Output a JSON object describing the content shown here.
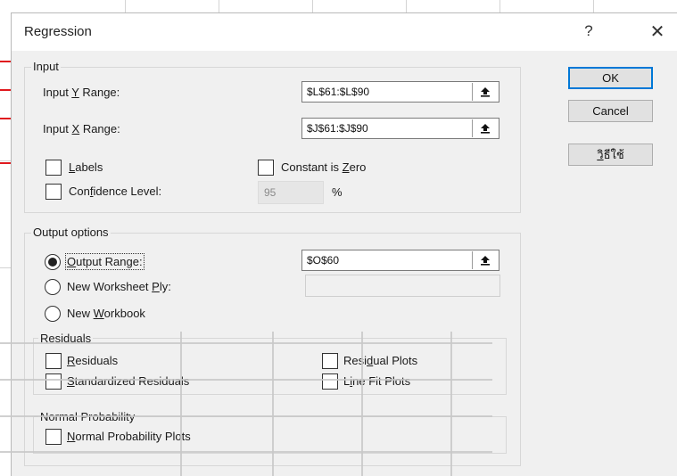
{
  "dialog": {
    "title": "Regression",
    "help_glyph": "?",
    "close_glyph": "✕"
  },
  "input_group": {
    "legend": "Input",
    "y_range": {
      "label_pre": "Input ",
      "label_key": "Y",
      "label_post": " Range:",
      "value": "$L$61:$L$90"
    },
    "x_range": {
      "label_pre": "Input ",
      "label_key": "X",
      "label_post": " Range:",
      "value": "$J$61:$J$90"
    },
    "labels": {
      "label_key": "L",
      "label_post": "abels",
      "checked": false
    },
    "constant_zero": {
      "label_pre": "Constant is ",
      "label_key": "Z",
      "label_post": "ero",
      "checked": false
    },
    "confidence": {
      "label_pre": "Con",
      "label_key": "f",
      "label_post": "idence Level:",
      "value": "95",
      "unit": "%",
      "checked": false
    }
  },
  "output_group": {
    "legend": "Output options",
    "output_range": {
      "label_pre": "",
      "label_key": "O",
      "label_post": "utput Range:",
      "value": "$O$60",
      "selected": true
    },
    "new_ply": {
      "label_pre": "New Worksheet ",
      "label_key": "P",
      "label_post": "ly:",
      "value": "",
      "selected": false
    },
    "new_workbook": {
      "label_pre": "New ",
      "label_key": "W",
      "label_post": "orkbook",
      "selected": false
    },
    "residuals_legend": "Residuals",
    "residuals": {
      "label_key": "R",
      "label_post": "esiduals",
      "checked": false
    },
    "standardized": {
      "label_key": "S",
      "label_post": "tandardized Residuals",
      "checked": false
    },
    "residual_plots": {
      "label_pre": "Resi",
      "label_key": "d",
      "label_post": "ual Plots",
      "checked": false
    },
    "line_fit": {
      "label_pre": "L",
      "label_key": "i",
      "label_post": "ne Fit Plots",
      "checked": false
    },
    "normal_legend": "Normal Probability",
    "normal_plots": {
      "label_key": "N",
      "label_post": "ormal Probability Plots",
      "checked": false
    }
  },
  "buttons": {
    "ok": "OK",
    "cancel": "Cancel",
    "help_key": "ว",
    "help_post": "ิธีใช้"
  },
  "icons": {
    "ref_button": "collapse-range-icon"
  }
}
